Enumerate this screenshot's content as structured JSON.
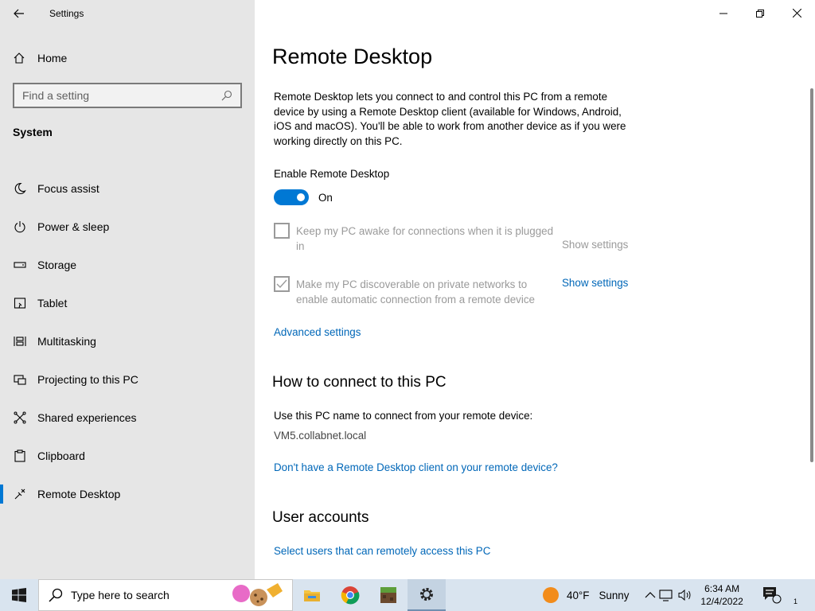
{
  "window": {
    "title": "Settings",
    "controls": [
      "minimize",
      "restore",
      "close"
    ]
  },
  "nav": {
    "home_label": "Home",
    "search_placeholder": "Find a setting",
    "section_title": "System",
    "items": [
      {
        "label": "Focus assist",
        "icon": "moon-icon"
      },
      {
        "label": "Power & sleep",
        "icon": "power-icon"
      },
      {
        "label": "Storage",
        "icon": "storage-icon"
      },
      {
        "label": "Tablet",
        "icon": "tablet-icon"
      },
      {
        "label": "Multitasking",
        "icon": "multitasking-icon"
      },
      {
        "label": "Projecting to this PC",
        "icon": "projecting-icon"
      },
      {
        "label": "Shared experiences",
        "icon": "shared-experiences-icon"
      },
      {
        "label": "Clipboard",
        "icon": "clipboard-icon"
      },
      {
        "label": "Remote Desktop",
        "icon": "remote-desktop-icon",
        "active": true
      }
    ]
  },
  "main": {
    "title": "Remote Desktop",
    "description": "Remote Desktop lets you connect to and control this PC from a remote device by using a Remote Desktop client (available for Windows, Android, iOS and macOS). You'll be able to work from another device as if you were working directly on this PC.",
    "enable_label": "Enable Remote Desktop",
    "toggle_state": "On",
    "option1": {
      "text": "Keep my PC awake for connections when it is plugged in",
      "checked": false,
      "show_settings": "Show settings"
    },
    "option2": {
      "text": "Make my PC discoverable on private networks to enable automatic connection from a remote device",
      "checked": true,
      "show_settings": "Show settings"
    },
    "advanced_link": "Advanced settings",
    "connect_heading": "How to connect to this PC",
    "connect_text": "Use this PC name to connect from your remote device:",
    "pc_name": "VM5.collabnet.local",
    "no_client_link": "Don't have a Remote Desktop client on your remote device?",
    "users_heading": "User accounts",
    "select_users_link": "Select users that can remotely access this PC"
  },
  "taskbar": {
    "search_placeholder": "Type here to search",
    "apps": [
      "file-explorer-icon",
      "chrome-icon",
      "minecraft-icon",
      "settings-icon"
    ],
    "weather_temp": "40°F",
    "weather_desc": "Sunny",
    "time": "6:34 AM",
    "date": "12/4/2022",
    "notification_count": "1"
  },
  "colors": {
    "accent": "#0078d4",
    "link": "#0067b8",
    "nav_bg": "#e6e6e6",
    "taskbar_bg": "#d9e4ef"
  }
}
